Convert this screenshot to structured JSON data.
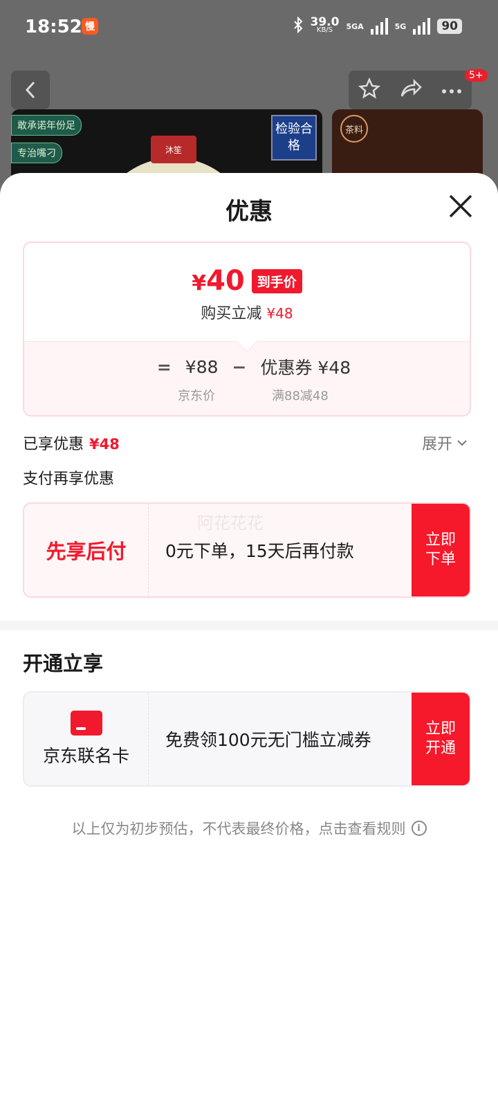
{
  "status_bar": {
    "time": "18:52",
    "app_badge": "慢",
    "speed_value": "39.0",
    "speed_unit": "KB/S",
    "net1": "5GA",
    "net2": "5G",
    "battery": "90"
  },
  "background": {
    "notification_count": "5+",
    "tags": [
      "敢承诺年份足",
      "专治嘴刁"
    ],
    "check_badge": "检验合格",
    "logo_text": "沐笙",
    "tea_stamp": "茶料"
  },
  "sheet": {
    "title": "优惠",
    "price": {
      "currency": "¥",
      "amount": "40",
      "final_tag": "到手价",
      "subtitle_prefix": "购买立减",
      "subtitle_amount": "¥48",
      "equals": "=",
      "base_price": "¥88",
      "minus": "−",
      "coupon": "优惠券 ¥48",
      "base_label": "京东价",
      "coupon_label": "满88减48"
    },
    "enjoyed_label": "已享优惠",
    "enjoyed_amount": "¥48",
    "expand_label": "展开",
    "pay_again_label": "支付再享优惠",
    "pay_later": {
      "name": "先享后付",
      "desc": "0元下单，15天后再付款",
      "watermark": "阿花花花",
      "button": "立即下单"
    },
    "section_title": "开通立享",
    "co_card": {
      "name": "京东联名卡",
      "desc": "免费领100元无门槛立减券",
      "button": "立即开通"
    },
    "disclaimer": "以上仅为初步预估，不代表最终价格，点击查看规则"
  },
  "colors": {
    "accent": "#f0192d",
    "button_red": "#f5192b"
  }
}
